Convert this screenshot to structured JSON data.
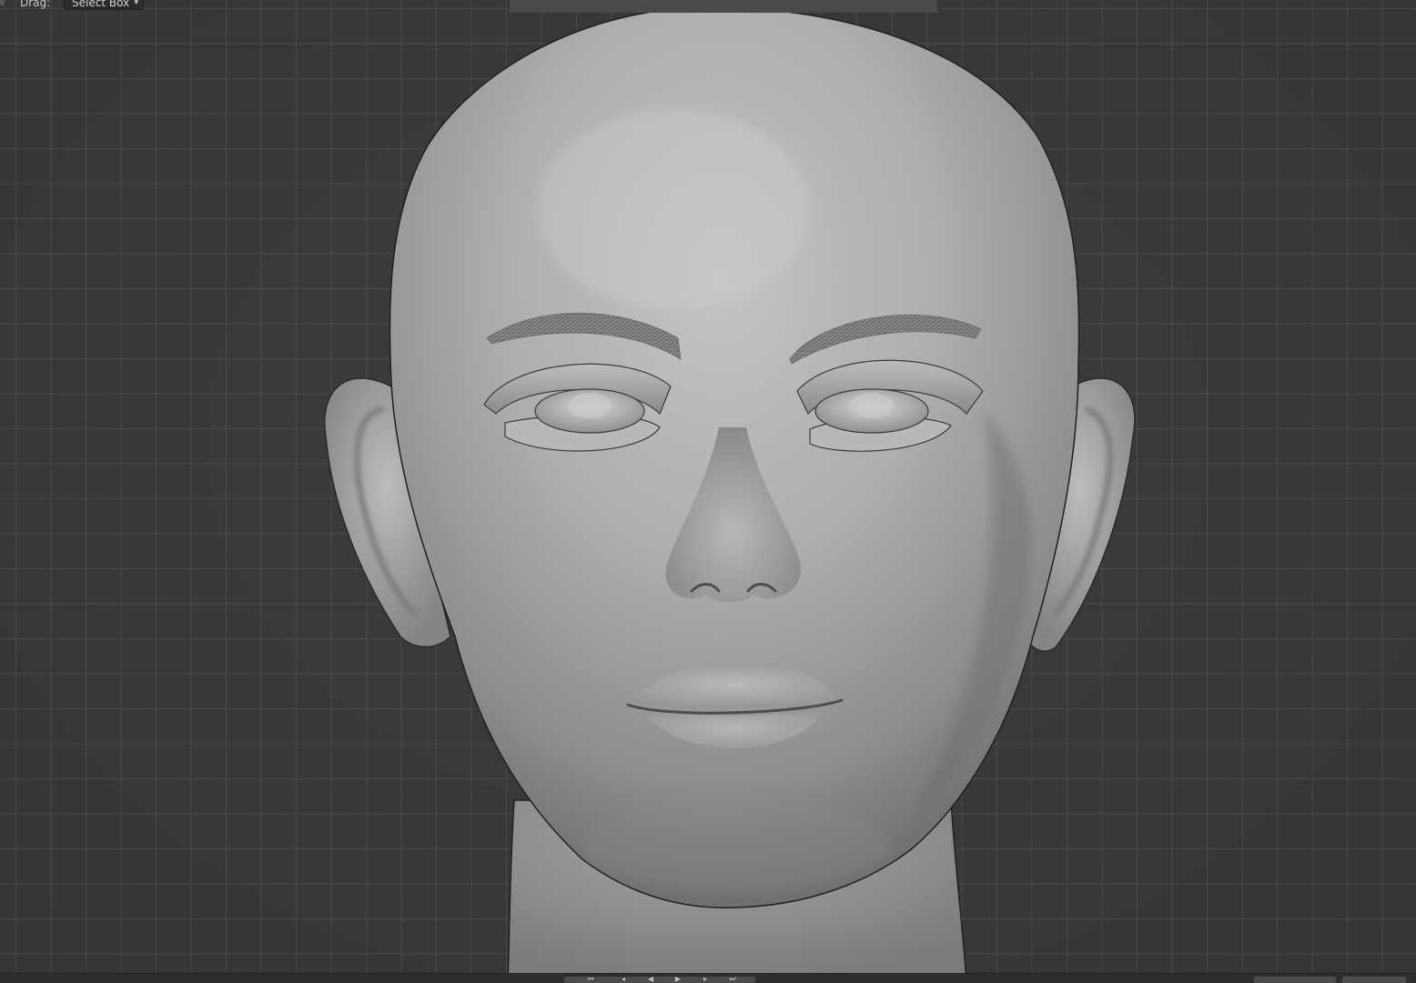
{
  "header": {
    "drag_label": "Drag:",
    "select_mode": "Select Box"
  },
  "colors": {
    "viewport_bg": "#393939",
    "grid_line": "#5a5a5a",
    "mesh_base": "#a9a9a9",
    "header_bg": "#4a4a4a"
  },
  "viewport": {
    "object": "head-mesh",
    "shading": "solid"
  },
  "icons": {
    "dropdown": "chevron-down-icon",
    "playback": [
      "jump-start-icon",
      "step-back-icon",
      "play-reverse-icon",
      "play-icon",
      "step-forward-icon",
      "jump-end-icon"
    ]
  }
}
